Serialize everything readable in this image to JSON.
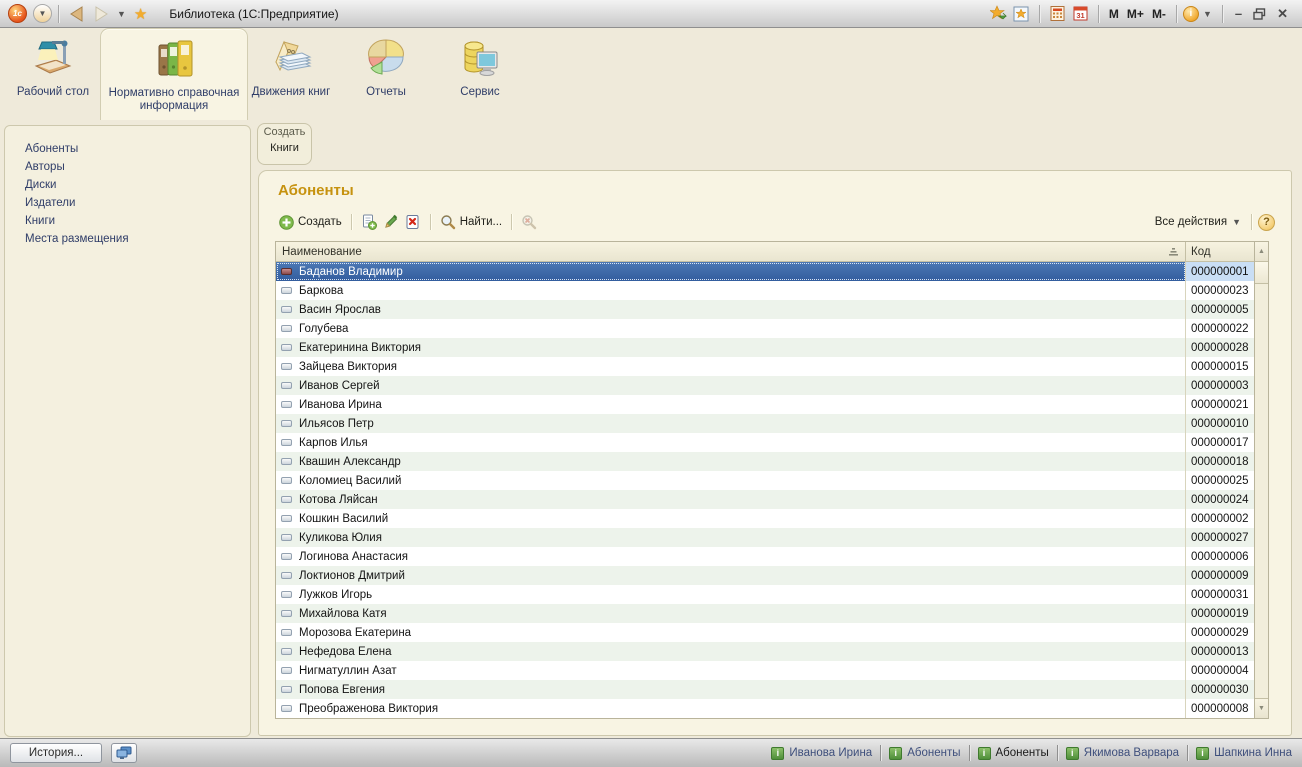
{
  "window": {
    "title": "Библиотека  (1С:Предприятие)"
  },
  "titlebar": {
    "logo_text": "1c",
    "m_label": "M",
    "m_plus_label": "M+",
    "m_minus_label": "M-",
    "calendar_day": "31",
    "info_glyph": "i"
  },
  "ribbon": {
    "tabs": [
      {
        "label": "Рабочий стол",
        "icon": "desk-lamp-icon",
        "selected": false
      },
      {
        "label": "Нормативно справочная информация",
        "icon": "binders-icon",
        "selected": true
      },
      {
        "label": "Движения книг",
        "icon": "ledger-stack-icon",
        "selected": false
      },
      {
        "label": "Отчеты",
        "icon": "pie-chart-icon",
        "selected": false
      },
      {
        "label": "Сервис",
        "icon": "database-monitor-icon",
        "selected": false
      }
    ]
  },
  "sidebar": {
    "items": [
      "Абоненты",
      "Авторы",
      "Диски",
      "Издатели",
      "Книги",
      "Места размещения"
    ]
  },
  "create_panel": {
    "title": "Создать",
    "items": [
      "Книги"
    ]
  },
  "main": {
    "title": "Абоненты",
    "toolbar": {
      "create_label": "Создать",
      "find_label": "Найти...",
      "all_actions_label": "Все действия",
      "help_glyph": "?"
    },
    "table": {
      "columns": [
        "Наименование",
        "Код"
      ],
      "selected_index": 0,
      "rows": [
        {
          "name": "Баданов Владимир",
          "code": "000000001"
        },
        {
          "name": "Баркова",
          "code": "000000023"
        },
        {
          "name": "Васин Ярослав",
          "code": "000000005"
        },
        {
          "name": "Голубева",
          "code": "000000022"
        },
        {
          "name": "Екатеринина Виктория",
          "code": "000000028"
        },
        {
          "name": "Зайцева Виктория",
          "code": "000000015"
        },
        {
          "name": "Иванов Сергей",
          "code": "000000003"
        },
        {
          "name": "Иванова Ирина",
          "code": "000000021"
        },
        {
          "name": "Ильясов Петр",
          "code": "000000010"
        },
        {
          "name": "Карпов Илья",
          "code": "000000017"
        },
        {
          "name": "Квашин Александр",
          "code": "000000018"
        },
        {
          "name": "Коломиец Василий",
          "code": "000000025"
        },
        {
          "name": "Котова Ляйсан",
          "code": "000000024"
        },
        {
          "name": "Кошкин Василий",
          "code": "000000002"
        },
        {
          "name": "Куликова Юлия",
          "code": "000000027"
        },
        {
          "name": "Логинова Анастасия",
          "code": "000000006"
        },
        {
          "name": "Локтионов Дмитрий",
          "code": "000000009"
        },
        {
          "name": "Лужков Игорь",
          "code": "000000031"
        },
        {
          "name": "Михайлова Катя",
          "code": "000000019"
        },
        {
          "name": "Морозова Екатерина",
          "code": "000000029"
        },
        {
          "name": "Нефедова Елена",
          "code": "000000013"
        },
        {
          "name": "Нигматуллин Азат",
          "code": "000000004"
        },
        {
          "name": "Попова Евгения",
          "code": "000000030"
        },
        {
          "name": "Преображенова Виктория",
          "code": "000000008"
        }
      ]
    }
  },
  "statusbar": {
    "history_label": "История...",
    "info_glyph": "i",
    "links": [
      {
        "label": "Иванова Ирина",
        "active": false
      },
      {
        "label": "Абоненты",
        "active": false
      },
      {
        "label": "Абоненты",
        "active": true
      },
      {
        "label": "Якимова Варвара",
        "active": false
      },
      {
        "label": "Шапкина Инна",
        "active": false
      }
    ]
  },
  "colors": {
    "selection_blue": "#3f68a9",
    "accent_gold": "#c6920f",
    "link_navy": "#2f3d68",
    "row_alt_green": "#edf3eb",
    "selected_code_bg": "#c9def5",
    "panel_bg": "#f8f4e3",
    "page_bg": "#efeada"
  }
}
